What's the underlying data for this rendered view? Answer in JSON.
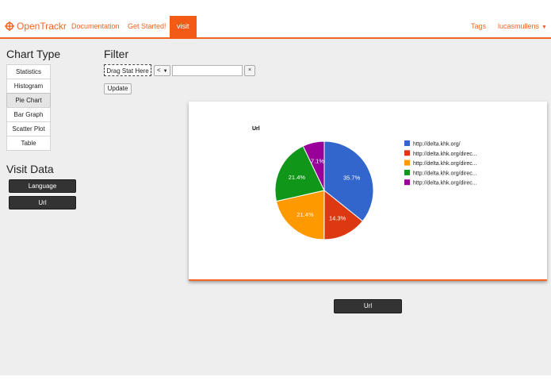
{
  "nav": {
    "brand": "OpenTrackr",
    "links": [
      "Documentation",
      "Get Started!",
      "visit"
    ],
    "right": [
      "Tags",
      "lucasmullens"
    ]
  },
  "sidebar": {
    "chart_type_title": "Chart Type",
    "chart_types": [
      "Statistics",
      "Histogram",
      "Pie Chart",
      "Bar Graph",
      "Scatter Plot",
      "Table"
    ],
    "selected_chart_type": "Pie Chart",
    "visit_data_title": "Visit Data",
    "visit_buttons": [
      "Language",
      "Url"
    ]
  },
  "filter": {
    "title": "Filter",
    "drag_placeholder": "Drag Stat Here",
    "operator": "<",
    "value": "",
    "clear_label": "×",
    "update_label": "Update"
  },
  "selected_stat_button": "Url",
  "colors": {
    "accent": "#f26522",
    "series": [
      "#3366cc",
      "#dc3912",
      "#ff9900",
      "#109618",
      "#990099"
    ]
  },
  "chart_data": {
    "type": "pie",
    "title": "Url",
    "legend_position": "right",
    "categories": [
      "http://delta.khk.org/",
      "http://delta.khk.org/direc...",
      "http://delta.khk.org/direc...",
      "http://delta.khk.org/direc...",
      "http://delta.khk.org/direc..."
    ],
    "values": [
      35.7,
      14.3,
      21.4,
      21.4,
      7.1
    ],
    "value_labels": [
      "35.7%",
      "14.3%",
      "21.4%",
      "21.4%",
      "7.1%"
    ]
  }
}
